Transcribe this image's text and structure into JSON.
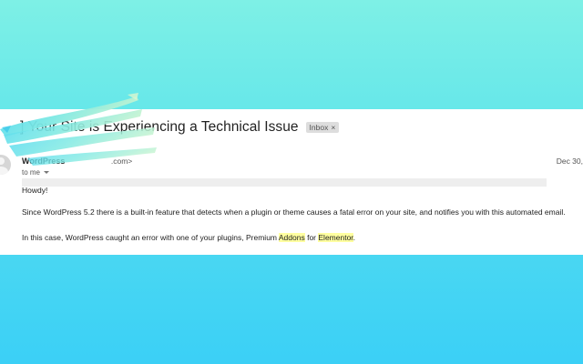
{
  "email": {
    "subject": "Your Site is Experiencing a Technical Issue",
    "subject_prefix_fragment": "]",
    "label": "Inbox",
    "label_close": "×",
    "sender_name": "WordPress",
    "sender_email_fragment": ".com>",
    "recipient": "to me",
    "date": "Dec 30,",
    "greeting": "Howdy!",
    "paragraph1": "Since WordPress 5.2 there is a built-in feature that detects when a plugin or theme causes a fatal error on your site, and notifies you with this automated email.",
    "paragraph2": {
      "before": "In this case, WordPress caught an error with one of your plugins, Premium ",
      "hl1": "Addons",
      "middle": " for ",
      "hl2": "Elementor",
      "after": "."
    }
  },
  "colors": {
    "background_top": "#7ef0e6",
    "background_bottom": "#3bd0f6",
    "highlight": "#ffffa0",
    "label_chip": "#dddddd"
  },
  "icons": {
    "avatar": "person-icon",
    "caret": "chevron-down-icon"
  }
}
